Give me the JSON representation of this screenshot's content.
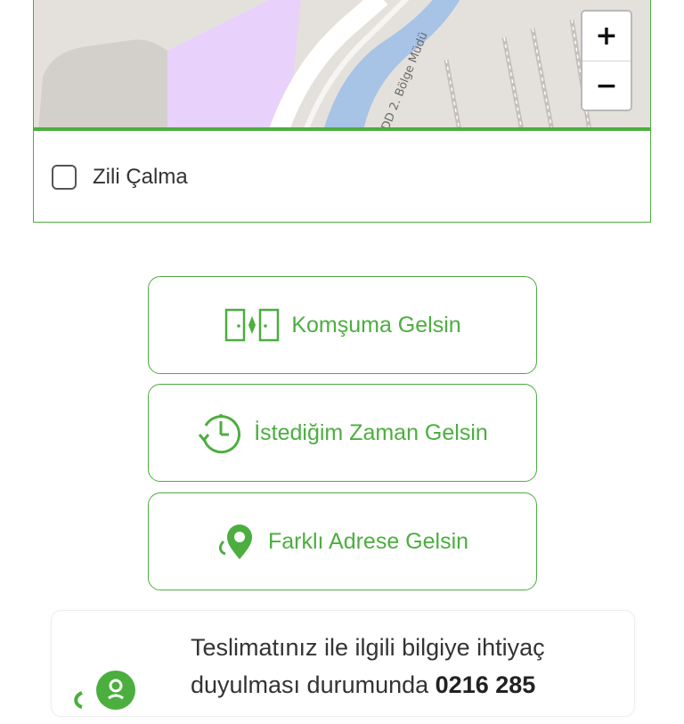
{
  "map": {
    "street_label": "DD 2. Bölge Müdü",
    "zoom_in": "+",
    "zoom_out": "−"
  },
  "ring_option": {
    "label": "Zili Çalma",
    "checked": false
  },
  "options": [
    {
      "label": "Komşuma Gelsin",
      "icon": "neighbor-doors-icon"
    },
    {
      "label": "İstediğim Zaman Gelsin",
      "icon": "clock-icon"
    },
    {
      "label": "Farklı Adrese Gelsin",
      "icon": "location-pin-icon"
    }
  ],
  "info": {
    "line1": "Teslimatınız ile ilgili bilgiye ihtiyaç",
    "line2_prefix": "duyulması durumunda ",
    "phone": "0216 285"
  },
  "colors": {
    "accent": "#4cae3f",
    "text": "#333333",
    "map_water": "#a7c3e6",
    "map_park": "#e8d2fb"
  }
}
